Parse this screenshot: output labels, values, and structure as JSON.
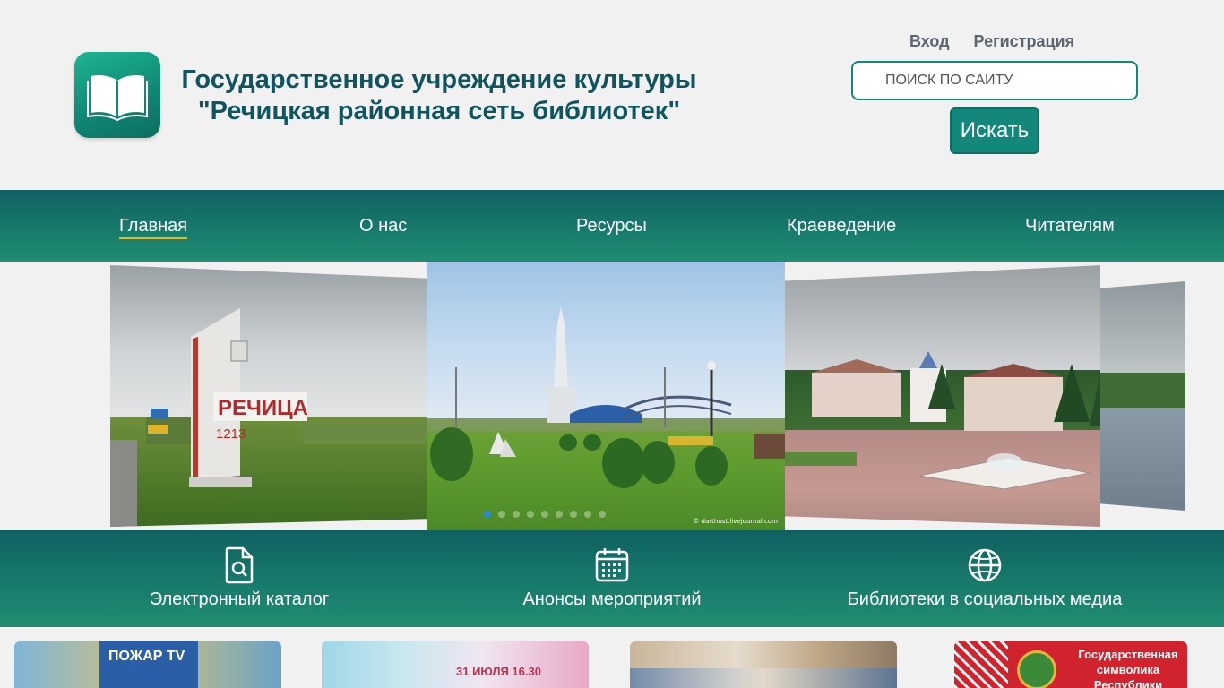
{
  "header": {
    "title_line1": "Государственное учреждение культуры",
    "title_line2": "\"Речицкая районная сеть библиотек\"",
    "login_label": "Вход",
    "register_label": "Регистрация"
  },
  "search": {
    "placeholder": "ПОИСК ПО САЙТУ",
    "button_label": "Искать"
  },
  "nav": {
    "items": [
      {
        "label": "Главная"
      },
      {
        "label": "О нас"
      },
      {
        "label": "Ресурсы"
      },
      {
        "label": "Краеведение"
      },
      {
        "label": "Читателям"
      }
    ]
  },
  "carousel": {
    "sign_name": "РЕЧИЦА",
    "sign_year": "1213",
    "watermark": "© darthust.livejournal.com",
    "dots_count": 9,
    "active_dot": 1
  },
  "quick_links": [
    {
      "label": "Электронный каталог",
      "icon": "document-search-icon"
    },
    {
      "label": "Анонсы мероприятий",
      "icon": "calendar-icon"
    },
    {
      "label": "Библиотеки в социальных медиа",
      "icon": "globe-icon"
    }
  ],
  "cards": [
    {
      "caption": "ПОЖАР TV"
    },
    {
      "caption": "31 ИЮЛЯ 16.30"
    },
    {
      "caption": ""
    },
    {
      "caption": "Государственная символика Республики Беларусь"
    }
  ],
  "colors": {
    "brand": "#13877a",
    "title": "#0f5560",
    "nav_accent": "#e8b820",
    "dot_active": "#2d8ad8"
  }
}
